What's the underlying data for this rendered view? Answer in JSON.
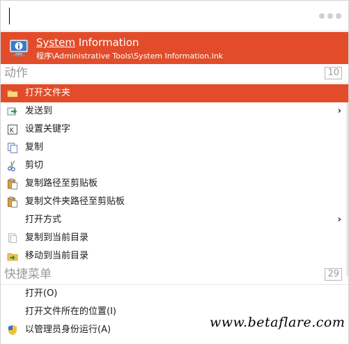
{
  "search": {
    "value": ""
  },
  "result": {
    "title_underlined": "System",
    "title_rest": " Information",
    "path": "程序\\Administrative Tools\\System Information.lnk"
  },
  "sections": {
    "actions": {
      "title": "动作",
      "count": "10"
    },
    "quick_menu": {
      "title": "快捷菜单",
      "count": "29"
    }
  },
  "actions": [
    {
      "label": "打开文件夹",
      "icon": "folder-icon",
      "selected": true,
      "submenu": false
    },
    {
      "label": "发送到",
      "icon": "send-to-icon",
      "selected": false,
      "submenu": true
    },
    {
      "label": "设置关键字",
      "icon": "keyword-icon",
      "selected": false,
      "submenu": false
    },
    {
      "label": "复制",
      "icon": "copy-icon",
      "selected": false,
      "submenu": false
    },
    {
      "label": "剪切",
      "icon": "scissors-icon",
      "selected": false,
      "submenu": false
    },
    {
      "label": "复制路径至剪贴板",
      "icon": "clipboard-icon",
      "selected": false,
      "submenu": false
    },
    {
      "label": "复制文件夹路径至剪贴板",
      "icon": "clipboard-icon",
      "selected": false,
      "submenu": false
    },
    {
      "label": "打开方式",
      "icon": "",
      "selected": false,
      "submenu": true
    },
    {
      "label": "复制到当前目录",
      "icon": "copy-to-icon",
      "selected": false,
      "submenu": false
    },
    {
      "label": "移动到当前目录",
      "icon": "move-to-icon",
      "selected": false,
      "submenu": false
    }
  ],
  "quick_menu": [
    {
      "label": "打开(O)",
      "icon": ""
    },
    {
      "label": "打开文件所在的位置(I)",
      "icon": ""
    },
    {
      "label": "以管理员身份运行(A)",
      "icon": "uac-shield-icon"
    }
  ],
  "watermark": "www.betaflare.com",
  "colors": {
    "accent": "#e24c2a",
    "section_text": "#9a9a9a"
  }
}
